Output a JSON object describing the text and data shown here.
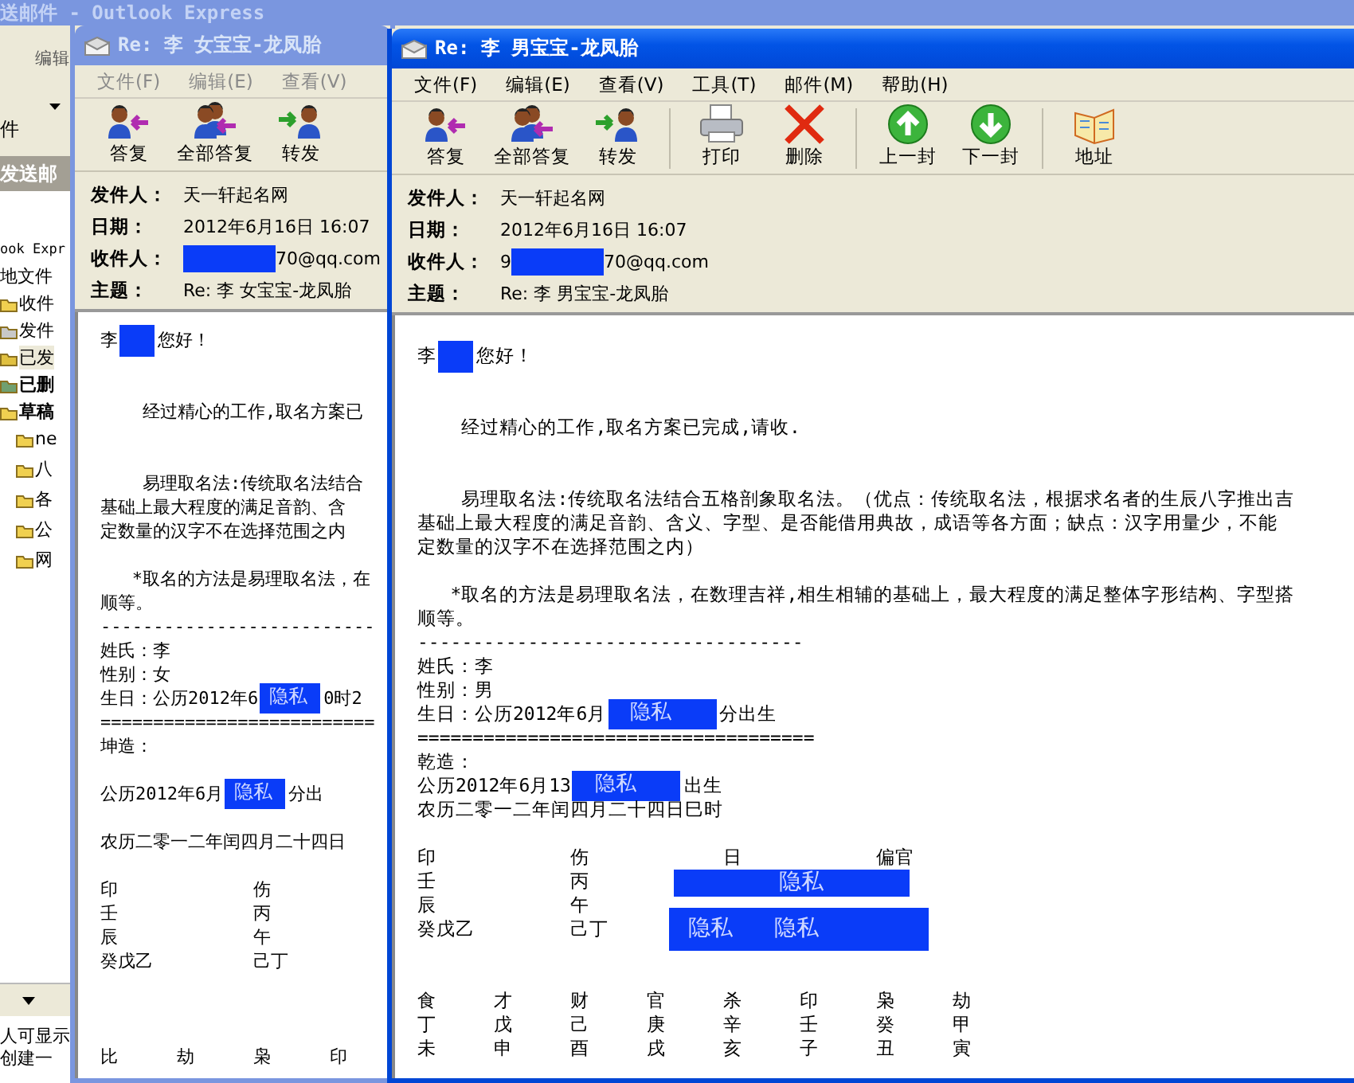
{
  "background_window": {
    "title": "送邮件 - Outlook Express",
    "menu": [
      "编辑"
    ],
    "toolbar_label": "件",
    "folder_bar": "发送邮",
    "tree": [
      {
        "text": "ook Expr",
        "kind": "root",
        "selected": false,
        "unread": false,
        "children": [
          {
            "text": "地文件",
            "selected": false,
            "unread": false,
            "children": [
              {
                "text": "收件",
                "kind": "inbox",
                "selected": false,
                "unread": false
              },
              {
                "text": "发件",
                "kind": "outbox",
                "selected": false,
                "unread": false
              },
              {
                "text": "已发",
                "kind": "sent",
                "selected": true,
                "unread": false
              },
              {
                "text": "已删",
                "kind": "trash",
                "selected": false,
                "unread": true
              },
              {
                "text": "草稿",
                "kind": "drafts",
                "selected": false,
                "unread": true,
                "children": [
                  {
                    "text": "ne",
                    "kind": "folder",
                    "selected": false,
                    "unread": false
                  },
                  {
                    "text": "八",
                    "kind": "folder",
                    "selected": false,
                    "unread": false
                  },
                  {
                    "text": "各",
                    "kind": "folder",
                    "selected": false,
                    "unread": false
                  },
                  {
                    "text": "公",
                    "kind": "folder",
                    "selected": false,
                    "unread": false
                  },
                  {
                    "text": "网",
                    "kind": "folder",
                    "selected": false,
                    "unread": false
                  }
                ]
              }
            ]
          }
        ]
      }
    ],
    "notes": [
      "人可显示",
      "创建一"
    ]
  },
  "windows": [
    {
      "title": "Re: 李 女宝宝-龙凤胎",
      "active": false,
      "menu": [
        "文件(F)",
        "编辑(E)",
        "查看(V)"
      ],
      "toolbar": [
        {
          "kind": "reply",
          "label": "答复",
          "separator_before": false
        },
        {
          "kind": "reply-all",
          "label": "全部答复",
          "separator_before": false
        },
        {
          "kind": "forward",
          "label": "转发",
          "separator_before": false
        }
      ],
      "headers": [
        {
          "label": "发件人：",
          "value": [
            {
              "kind": "text",
              "text": "天一轩起名网"
            }
          ]
        },
        {
          "label": "日期：",
          "value": [
            {
              "kind": "text",
              "text": "2012年6月16日 16:07"
            }
          ]
        },
        {
          "label": "收件人：",
          "value": [
            {
              "kind": "redaction"
            },
            {
              "kind": "text",
              "text": "70@qq.com"
            }
          ]
        },
        {
          "label": "主题：",
          "value": [
            {
              "kind": "text",
              "text": "Re: 李 女宝宝-龙凤胎"
            }
          ]
        }
      ],
      "body": [
        {
          "kind": "line",
          "segments": [
            {
              "kind": "text",
              "text": "李"
            },
            {
              "kind": "redaction"
            },
            {
              "kind": "text",
              "text": "您好！"
            }
          ]
        },
        {
          "kind": "gap"
        },
        {
          "kind": "gap"
        },
        {
          "kind": "line",
          "segments": [
            {
              "kind": "text",
              "text": "    经过精心的工作,取名方案已"
            }
          ]
        },
        {
          "kind": "gap"
        },
        {
          "kind": "gap"
        },
        {
          "kind": "line",
          "segments": [
            {
              "kind": "text",
              "text": "    易理取名法:传统取名法结合"
            }
          ]
        },
        {
          "kind": "line",
          "segments": [
            {
              "kind": "text",
              "text": "基础上最大程度的满足音韵、含"
            }
          ]
        },
        {
          "kind": "line",
          "segments": [
            {
              "kind": "text",
              "text": "定数量的汉字不在选择范围之内"
            }
          ]
        },
        {
          "kind": "gap"
        },
        {
          "kind": "line",
          "segments": [
            {
              "kind": "text",
              "text": "   *取名的方法是易理取名法，在"
            }
          ]
        },
        {
          "kind": "line",
          "segments": [
            {
              "kind": "text",
              "text": "顺等。"
            }
          ]
        },
        {
          "kind": "line",
          "segments": [
            {
              "kind": "text",
              "text": "--------------------------"
            }
          ]
        },
        {
          "kind": "line",
          "segments": [
            {
              "kind": "text",
              "text": "姓氏：李"
            }
          ]
        },
        {
          "kind": "line",
          "segments": [
            {
              "kind": "text",
              "text": "性别：女"
            }
          ]
        },
        {
          "kind": "line",
          "segments": [
            {
              "kind": "text",
              "text": "生日：公历2012年6"
            },
            {
              "kind": "redaction",
              "label": "隐私"
            },
            {
              "kind": "text",
              "text": "0时2"
            }
          ]
        },
        {
          "kind": "line",
          "segments": [
            {
              "kind": "text",
              "text": "=========================="
            }
          ]
        },
        {
          "kind": "line",
          "segments": [
            {
              "kind": "text",
              "text": "坤造："
            }
          ]
        },
        {
          "kind": "gap"
        },
        {
          "kind": "line",
          "segments": [
            {
              "kind": "text",
              "text": "公历2012年6月"
            },
            {
              "kind": "redaction",
              "label": "隐私"
            },
            {
              "kind": "text",
              "text": "分出"
            }
          ]
        },
        {
          "kind": "gap"
        },
        {
          "kind": "line",
          "segments": [
            {
              "kind": "text",
              "text": "农历二零一二年闰四月二十四日"
            }
          ]
        },
        {
          "kind": "gap"
        },
        {
          "kind": "wide-row",
          "cells": [
            "印",
            "伤"
          ]
        },
        {
          "kind": "wide-row",
          "cells": [
            "壬",
            "丙"
          ]
        },
        {
          "kind": "wide-row",
          "cells": [
            "辰",
            "午"
          ]
        },
        {
          "kind": "wide-row",
          "cells": [
            "癸戊乙",
            "己丁"
          ]
        },
        {
          "kind": "gap"
        },
        {
          "kind": "gap"
        },
        {
          "kind": "gap"
        },
        {
          "kind": "row",
          "cells": [
            "比",
            "劫",
            "枭",
            "印"
          ]
        }
      ]
    },
    {
      "title": "Re: 李 男宝宝-龙凤胎",
      "active": true,
      "menu": [
        "文件(F)",
        "编辑(E)",
        "查看(V)",
        "工具(T)",
        "邮件(M)",
        "帮助(H)"
      ],
      "toolbar": [
        {
          "kind": "reply",
          "label": "答复",
          "separator_before": false
        },
        {
          "kind": "reply-all",
          "label": "全部答复",
          "separator_before": false
        },
        {
          "kind": "forward",
          "label": "转发",
          "separator_before": false
        },
        {
          "kind": "print",
          "label": "打印",
          "separator_before": true
        },
        {
          "kind": "delete",
          "label": "删除",
          "separator_before": false
        },
        {
          "kind": "previous",
          "label": "上一封",
          "separator_before": true
        },
        {
          "kind": "next",
          "label": "下一封",
          "separator_before": false
        },
        {
          "kind": "address",
          "label": "地址",
          "separator_before": true
        }
      ],
      "headers": [
        {
          "label": "发件人：",
          "value": [
            {
              "kind": "text",
              "text": "天一轩起名网"
            }
          ]
        },
        {
          "label": "日期：",
          "value": [
            {
              "kind": "text",
              "text": "2012年6月16日 16:07"
            }
          ]
        },
        {
          "label": "收件人：",
          "value": [
            {
              "kind": "text",
              "text": "9"
            },
            {
              "kind": "redaction"
            },
            {
              "kind": "text",
              "text": "70@qq.com"
            }
          ]
        },
        {
          "label": "主题：",
          "value": [
            {
              "kind": "text",
              "text": "Re: 李 男宝宝-龙凤胎"
            }
          ]
        }
      ],
      "body": [
        {
          "kind": "line",
          "segments": [
            {
              "kind": "text",
              "text": "李"
            },
            {
              "kind": "redaction"
            },
            {
              "kind": "text",
              "text": "您好！"
            }
          ]
        },
        {
          "kind": "gap"
        },
        {
          "kind": "gap"
        },
        {
          "kind": "line",
          "segments": [
            {
              "kind": "text",
              "text": "    经过精心的工作,取名方案已完成,请收."
            }
          ]
        },
        {
          "kind": "gap"
        },
        {
          "kind": "gap"
        },
        {
          "kind": "line",
          "segments": [
            {
              "kind": "text",
              "text": "    易理取名法:传统取名法结合五格剖象取名法。（优点：传统取名法，根据求名者的生辰八字推出吉"
            }
          ]
        },
        {
          "kind": "line",
          "segments": [
            {
              "kind": "text",
              "text": "基础上最大程度的满足音韵、含义、字型、是否能借用典故，成语等各方面；缺点：汉字用量少，不能"
            }
          ]
        },
        {
          "kind": "line",
          "segments": [
            {
              "kind": "text",
              "text": "定数量的汉字不在选择范围之内）"
            }
          ]
        },
        {
          "kind": "gap"
        },
        {
          "kind": "line",
          "segments": [
            {
              "kind": "text",
              "text": "   *取名的方法是易理取名法，在数理吉祥,相生相辅的基础上，最大程度的满足整体字形结构、字型搭"
            }
          ]
        },
        {
          "kind": "line",
          "segments": [
            {
              "kind": "text",
              "text": "顺等。"
            }
          ]
        },
        {
          "kind": "line",
          "segments": [
            {
              "kind": "text",
              "text": "-----------------------------------"
            }
          ]
        },
        {
          "kind": "line",
          "segments": [
            {
              "kind": "text",
              "text": "姓氏：李"
            }
          ]
        },
        {
          "kind": "line",
          "segments": [
            {
              "kind": "text",
              "text": "性别：男"
            }
          ]
        },
        {
          "kind": "line",
          "segments": [
            {
              "kind": "text",
              "text": "生日：公历2012年6月"
            },
            {
              "kind": "redaction",
              "label": "隐私"
            },
            {
              "kind": "text",
              "text": "分出生"
            }
          ]
        },
        {
          "kind": "line",
          "segments": [
            {
              "kind": "text",
              "text": "===================================="
            }
          ]
        },
        {
          "kind": "line",
          "segments": [
            {
              "kind": "text",
              "text": "乾造："
            }
          ]
        },
        {
          "kind": "line",
          "segments": [
            {
              "kind": "text",
              "text": "公历2012年6月13"
            },
            {
              "kind": "redaction",
              "label": "隐私"
            },
            {
              "kind": "text",
              "text": "出生"
            }
          ]
        },
        {
          "kind": "line",
          "segments": [
            {
              "kind": "text",
              "text": "农历二零一二年闰四月二十四日巳时"
            }
          ]
        },
        {
          "kind": "gap"
        },
        {
          "kind": "wide-row",
          "cells": [
            "印",
            "伤",
            "日",
            "偏官"
          ]
        },
        {
          "kind": "wide-row",
          "cells": [
            "壬",
            "丙"
          ],
          "redaction": [
            "隐私"
          ]
        },
        {
          "kind": "wide-row",
          "cells": [
            "辰",
            "午"
          ]
        },
        {
          "kind": "wide-row",
          "cells": [
            "癸戊乙",
            "己丁"
          ],
          "redaction": [
            "隐私",
            "隐私"
          ]
        },
        {
          "kind": "gap"
        },
        {
          "kind": "gap"
        },
        {
          "kind": "row",
          "cells": [
            "食",
            "才",
            "财",
            "官",
            "杀",
            "印",
            "枭",
            "劫"
          ]
        },
        {
          "kind": "row",
          "cells": [
            "丁",
            "戊",
            "己",
            "庚",
            "辛",
            "壬",
            "癸",
            "甲"
          ]
        },
        {
          "kind": "row",
          "cells": [
            "未",
            "申",
            "酉",
            "戌",
            "亥",
            "子",
            "丑",
            "寅"
          ]
        }
      ]
    }
  ]
}
